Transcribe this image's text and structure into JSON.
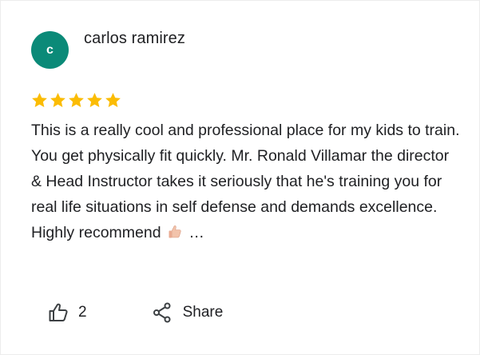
{
  "review": {
    "avatar_letter": "c",
    "avatar_color": "#0b8a78",
    "reviewer_name": "carlos ramirez",
    "rating": 5,
    "star_color": "#fbbc04",
    "text": "This is a really cool and professional place for my kids to train. You get physically fit quickly. Mr. Ronald Villamar the director & Head Instructor takes it seriously that he's training you for real life situations in self defense and demands excellence. Highly recommend",
    "truncation": "…"
  },
  "actions": {
    "like_icon": "thumbs-up-icon",
    "like_count": "2",
    "share_icon": "share-icon",
    "share_label": "Share"
  }
}
